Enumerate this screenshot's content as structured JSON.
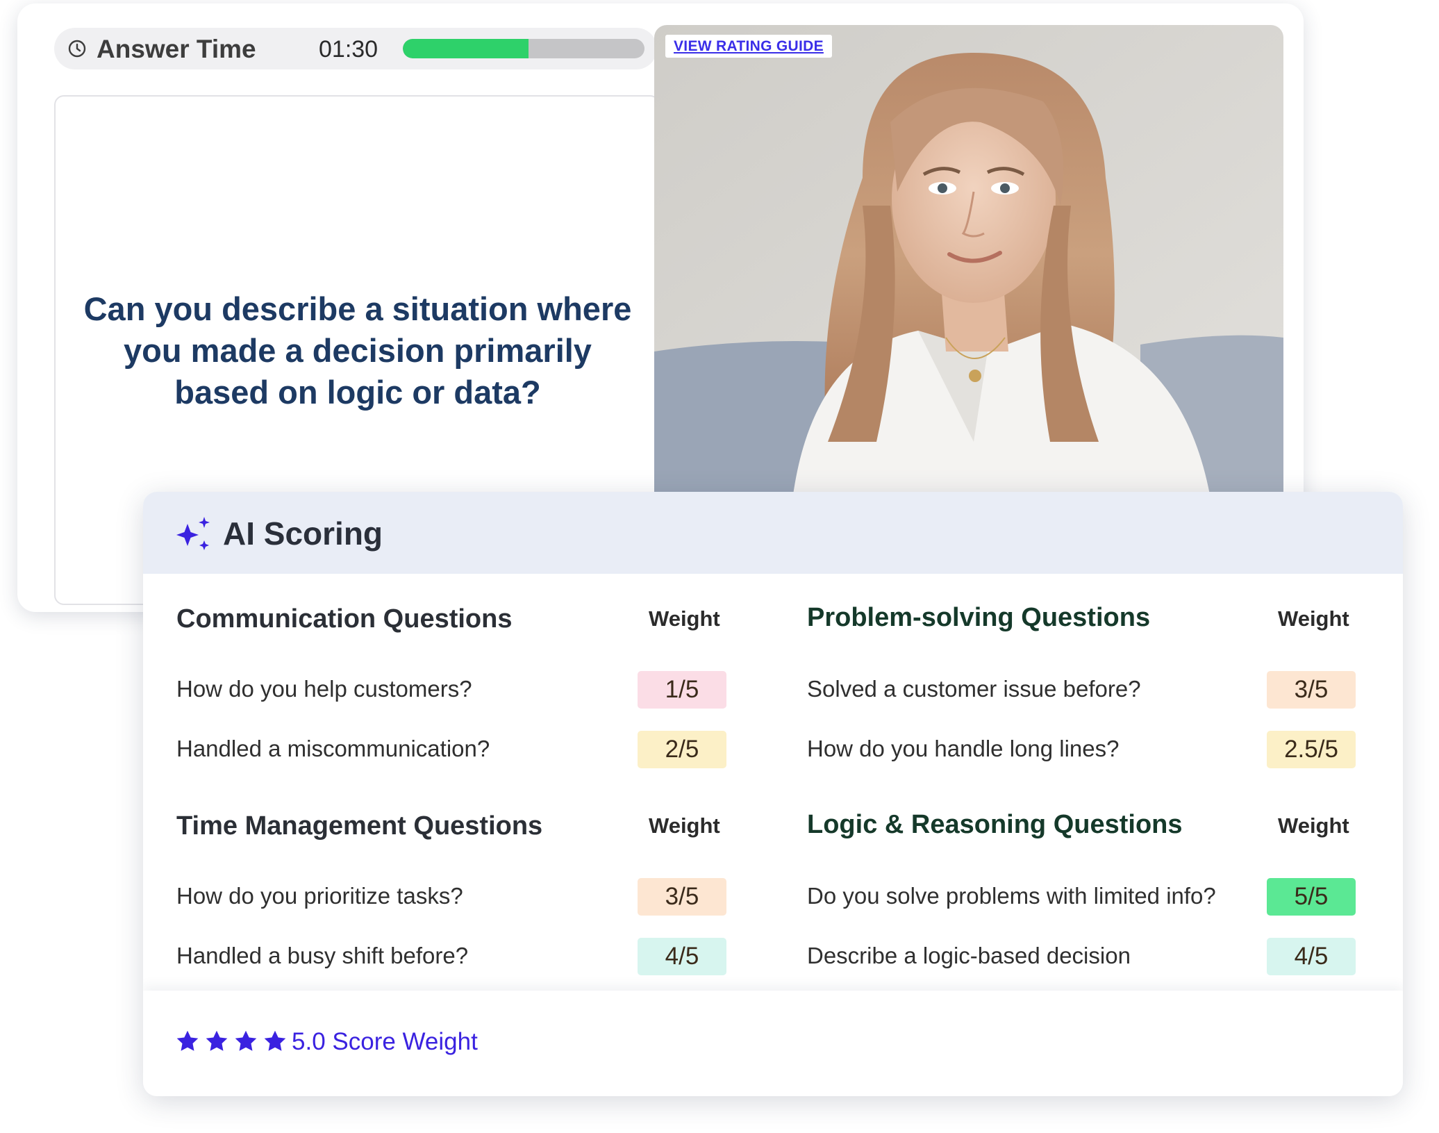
{
  "timer": {
    "label": "Answer Time",
    "time": "01:30",
    "progress_fraction": 0.52,
    "progress_color": "#2ed16a"
  },
  "question": {
    "text": "Can you describe a situation where you made a decision primarily based on logic or data?"
  },
  "video": {
    "rating_guide_link": "VIEW RATING GUIDE"
  },
  "scoring": {
    "title": "AI Scoring",
    "icon": "sparkle-icon",
    "sections": [
      {
        "title": "Communication Questions",
        "weight_label": "Weight",
        "items": [
          {
            "question": "How do you help customers?",
            "score": "1/5",
            "color": "#fbdde6"
          },
          {
            "question": "Handled a miscommunication?",
            "score": "2/5",
            "color": "#fcf0c7"
          }
        ]
      },
      {
        "title": "Problem-solving Questions",
        "weight_label": "Weight",
        "items": [
          {
            "question": "Solved a customer issue before?",
            "score": "3/5",
            "color": "#fde6d2"
          },
          {
            "question": "How do you handle long lines?",
            "score": "2.5/5",
            "color": "#fcf0c7"
          }
        ]
      },
      {
        "title": "Time Management Questions",
        "weight_label": "Weight",
        "items": [
          {
            "question": "How do you prioritize tasks?",
            "score": "3/5",
            "color": "#fde6d2"
          },
          {
            "question": "Handled a busy shift before?",
            "score": "4/5",
            "color": "#d7f5ef"
          }
        ]
      },
      {
        "title": "Logic & Reasoning Questions",
        "weight_label": "Weight",
        "items": [
          {
            "question": "Do you solve problems with limited info?",
            "score": "5/5",
            "color": "#5be894"
          },
          {
            "question": "Describe a logic-based decision",
            "score": "4/5",
            "color": "#d7f5ef"
          }
        ]
      }
    ],
    "footer": {
      "stars": 4,
      "star_color": "#3a22e0",
      "text": "5.0 Score Weight"
    }
  }
}
